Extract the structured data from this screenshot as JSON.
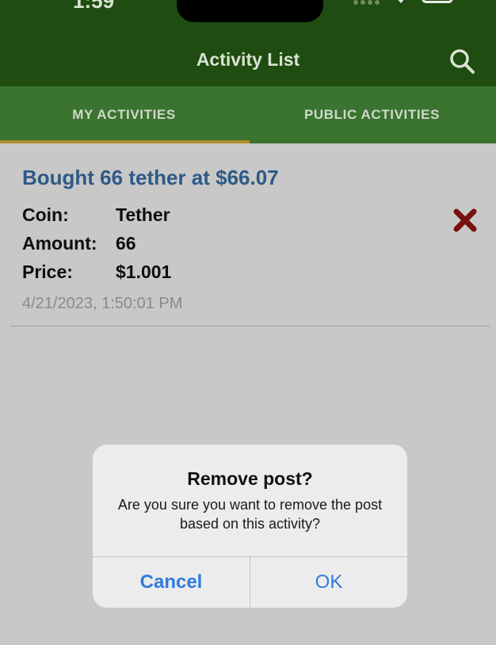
{
  "status_bar": {
    "time": "1:59"
  },
  "header": {
    "title": "Activity List"
  },
  "tabs": [
    {
      "label": "MY ACTIVITIES",
      "active": true
    },
    {
      "label": "PUBLIC ACTIVITIES",
      "active": false
    }
  ],
  "activity": {
    "title": "Bought 66 tether at $66.07",
    "fields": [
      {
        "label": "Coin:",
        "value": "Tether"
      },
      {
        "label": "Amount:",
        "value": "66"
      },
      {
        "label": "Price:",
        "value": "$1.001"
      }
    ],
    "timestamp": "4/21/2023, 1:50:01 PM"
  },
  "alert": {
    "title": "Remove post?",
    "message": "Are you sure you want to remove the post based on this activity?",
    "cancel_label": "Cancel",
    "ok_label": "OK"
  },
  "colors": {
    "header_bg": "#1f4c10",
    "tab_bg": "#3a7430",
    "tab_indicator": "#b58e2c",
    "title_blue": "#2d5a86",
    "delete_red": "#7a1010",
    "ios_blue": "#2f7ae0"
  },
  "icons": {
    "search": "search-icon",
    "delete": "close-x-icon",
    "wifi": "wifi-icon",
    "battery": "battery-icon"
  }
}
